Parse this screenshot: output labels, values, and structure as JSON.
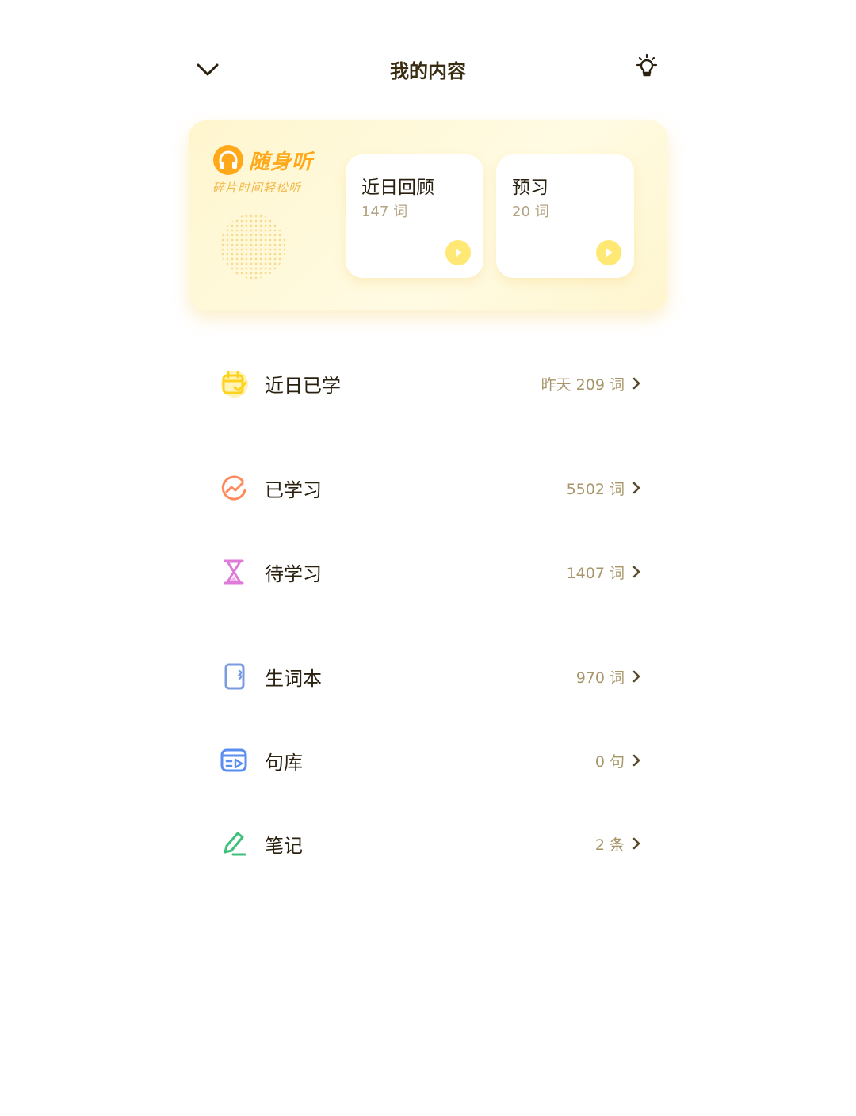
{
  "header": {
    "title": "我的内容",
    "back_icon": "chevron-down-icon",
    "bulb_icon": "lightbulb-icon"
  },
  "card": {
    "brand_name": "随身听",
    "brand_slogan": "碎片时间轻松听",
    "items": [
      {
        "title": "近日回顾",
        "count": "147 词"
      },
      {
        "title": "预习",
        "count": "20 词"
      }
    ]
  },
  "list": [
    {
      "label": "近日已学",
      "value": "昨天 209 词",
      "icon": "calendar-check-icon",
      "color": "#ffd21e"
    },
    {
      "label": "已学习",
      "value": "5502 词",
      "icon": "progress-chart-icon",
      "color": "#ff8a5b"
    },
    {
      "label": "待学习",
      "value": "1407 词",
      "icon": "hourglass-icon",
      "color": "#e07ad8"
    },
    {
      "label": "生词本",
      "value": "970 词",
      "icon": "notebook-icon",
      "color": "#7a9be0"
    },
    {
      "label": "句库",
      "value": "0 句",
      "icon": "sentence-library-icon",
      "color": "#5b8ef0"
    },
    {
      "label": "笔记",
      "value": "2 条",
      "icon": "pen-icon",
      "color": "#3ec07a"
    }
  ],
  "colors": {
    "accent": "#ffa81a",
    "card_bg": "#fff6cf",
    "value_text": "#a8966a"
  }
}
